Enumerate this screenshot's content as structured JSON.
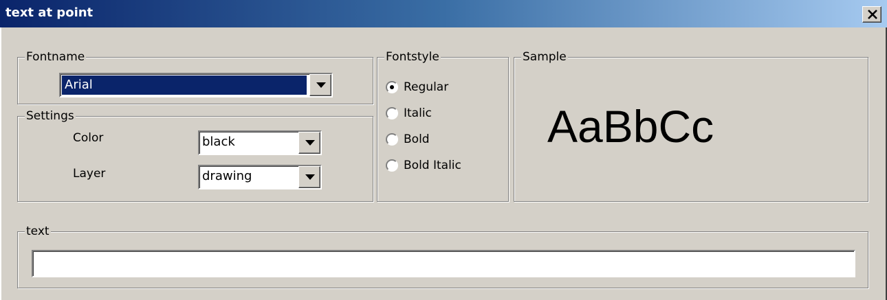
{
  "window": {
    "title": "text at point",
    "close_icon": "close-x-icon"
  },
  "fontname": {
    "legend": "Fontname",
    "value": "Arial"
  },
  "settings": {
    "legend": "Settings",
    "color_label": "Color",
    "color_value": "black",
    "layer_label": "Layer",
    "layer_value": "drawing"
  },
  "fontstyle": {
    "legend": "Fontstyle",
    "options": [
      "Regular",
      "Italic",
      "Bold",
      "Bold Italic"
    ],
    "selected": "Regular"
  },
  "sample": {
    "legend": "Sample",
    "text": "AaBbCc"
  },
  "text_group": {
    "legend": "text",
    "value": ""
  },
  "colors": {
    "title_gradient_start": "#0a246a",
    "title_gradient_end": "#a6caf0",
    "dialog_bg": "#d4d0c8",
    "selection": "#0a246a"
  }
}
